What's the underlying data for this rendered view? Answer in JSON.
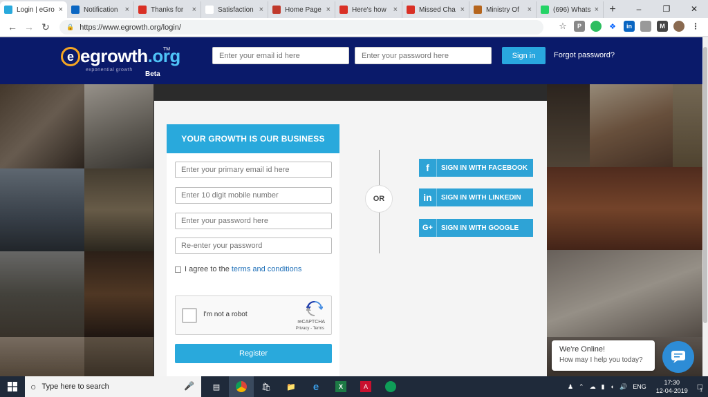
{
  "browser": {
    "tabs": [
      {
        "label": "Login | eGro",
        "favicon": "egrowth-favicon",
        "color": "#29a9dc",
        "active": true
      },
      {
        "label": "Notification",
        "favicon": "linkedin-favicon",
        "color": "#0a66c2",
        "active": false
      },
      {
        "label": "Thanks for",
        "favicon": "gmail-favicon",
        "color": "#d93025",
        "active": false
      },
      {
        "label": "Satisfaction",
        "favicon": "blank-favicon",
        "color": "#ffffff",
        "active": false
      },
      {
        "label": "Home Page",
        "favicon": "page-favicon",
        "color": "#c0392b",
        "active": false
      },
      {
        "label": "Here's how",
        "favicon": "gmail-favicon",
        "color": "#d93025",
        "active": false
      },
      {
        "label": "Missed Cha",
        "favicon": "gmail-favicon",
        "color": "#d93025",
        "active": false
      },
      {
        "label": "Ministry Of",
        "favicon": "emblem-favicon",
        "color": "#b5651d",
        "active": false
      },
      {
        "label": "(696) Whats",
        "favicon": "whatsapp-favicon",
        "color": "#25d366",
        "active": false
      }
    ],
    "new_tab_label": "+",
    "url": "https://www.egrowth.org/login/"
  },
  "header": {
    "logo_main": "egrowth",
    "logo_org": ".org",
    "logo_tagline": "exponential growth",
    "logo_beta": "Beta",
    "logo_tm": "TM",
    "email_placeholder": "Enter your email id here",
    "password_placeholder": "Enter your password here",
    "signin_label": "Sign in",
    "forgot_label": "Forgot password?"
  },
  "register_form": {
    "heading": "YOUR GROWTH IS OUR BUSINESS",
    "email_placeholder": "Enter your primary email id here",
    "mobile_placeholder": "Enter 10 digit mobile number",
    "password_placeholder": "Enter your password here",
    "reenter_placeholder": "Re-enter your password",
    "agree_text": "I agree to the",
    "terms_link": "terms and conditions",
    "captcha_text": "I'm not a robot",
    "captcha_brand": "reCAPTCHA",
    "captcha_terms": "Privacy - Terms",
    "register_label": "Register"
  },
  "social": {
    "or_label": "OR",
    "facebook": {
      "icon": "f",
      "label": "SIGN IN WITH FACEBOOK"
    },
    "linkedin": {
      "icon": "in",
      "label": "SIGN IN WITH LINKEDIN"
    },
    "google": {
      "icon": "G+",
      "label": "SIGN IN WITH GOOGLE"
    }
  },
  "chat": {
    "line1": "We're Online!",
    "line2": "How may I help you today?"
  },
  "taskbar": {
    "search_placeholder": "Type here to search",
    "lang": "ENG",
    "time": "17:30",
    "date": "12-04-2019",
    "notif_count": "1"
  },
  "colors": {
    "header_bg": "#0a1a6a",
    "accent": "#29a9dc"
  }
}
